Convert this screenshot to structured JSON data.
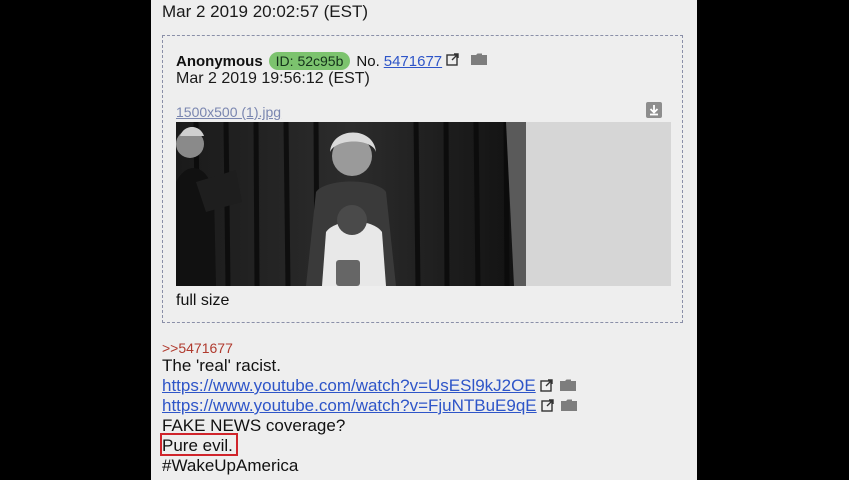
{
  "post": {
    "date": "Mar 2 2019 20:02:57 (EST)"
  },
  "quoted_post": {
    "name": "Anonymous",
    "id_label": "ID: 52c95b",
    "no_prefix": "No.",
    "no_number": "5471677",
    "date": "Mar 2 2019 19:56:12 (EST)",
    "filename": "1500x500 (1).jpg",
    "full_size_label": "full size"
  },
  "body": {
    "quote_ref": ">>5471677",
    "line1": "The 'real' racist.",
    "link1": "https://www.youtube.com/watch?v=UsESl9kJ2OE",
    "link2": "https://www.youtube.com/watch?v=FjuNTBuE9qE",
    "line2": "FAKE NEWS coverage?",
    "line3": "Pure evil.",
    "line4": "#WakeUpAmerica"
  },
  "icons": {
    "external": "external-link-icon",
    "folder": "folder-icon",
    "download": "download-icon"
  },
  "colors": {
    "link": "#2e55c8",
    "id_badge": "#7cc36e",
    "quote_ref": "#b03a2e",
    "highlight": "#d0242b"
  }
}
